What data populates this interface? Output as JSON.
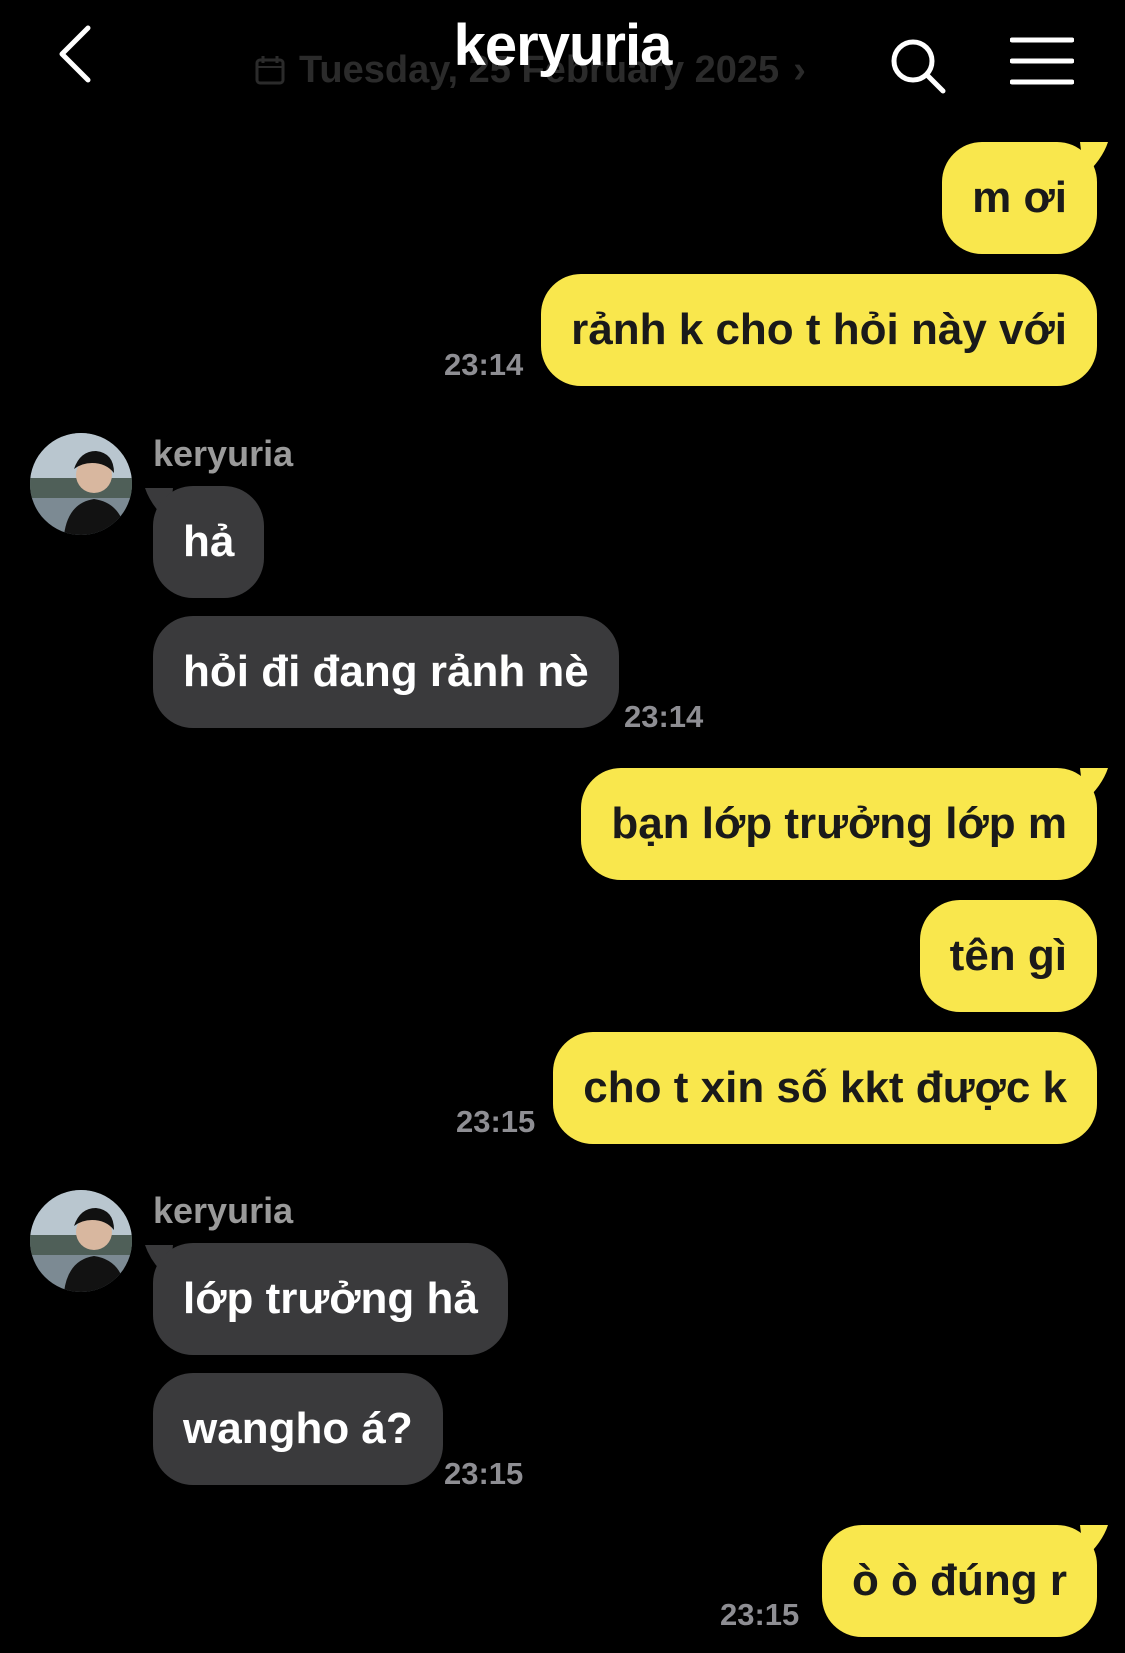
{
  "header": {
    "title": "keryuria",
    "date_banner": "Tuesday, 25 February 2025"
  },
  "colors": {
    "background": "#000000",
    "outgoing_bubble": "#f9e74d",
    "incoming_bubble": "#3a3a3c",
    "timestamp": "#8e8e93"
  },
  "icons": {
    "back": "chevron-left-icon",
    "search": "search-icon",
    "menu": "hamburger-menu-icon",
    "calendar": "calendar-icon"
  },
  "messages": [
    {
      "side": "out",
      "text": "m ơi"
    },
    {
      "side": "out",
      "text": "rảnh k cho t hỏi này với",
      "time": "23:14"
    },
    {
      "side": "in",
      "sender": "keryuria",
      "text": "hả"
    },
    {
      "side": "in",
      "text": "hỏi đi đang rảnh nè",
      "time": "23:14"
    },
    {
      "side": "out",
      "text": "bạn lớp trưởng lớp m"
    },
    {
      "side": "out",
      "text": "tên gì"
    },
    {
      "side": "out",
      "text": "cho t xin số kkt được k",
      "time": "23:15"
    },
    {
      "side": "in",
      "sender": "keryuria",
      "text": "lớp trưởng hả"
    },
    {
      "side": "in",
      "text": "wangho á?",
      "time": "23:15"
    },
    {
      "side": "out",
      "text": "ò ò đúng r",
      "time": "23:15"
    }
  ]
}
